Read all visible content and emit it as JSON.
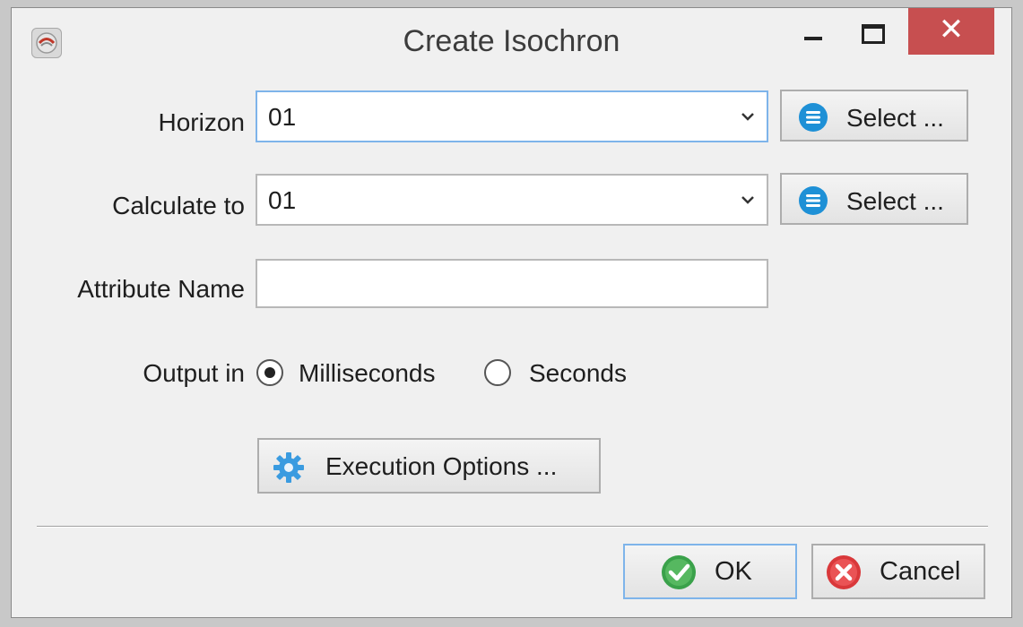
{
  "window": {
    "title": "Create Isochron",
    "close_glyph": "✕",
    "app_icon": "app-icon",
    "colors": {
      "close_bg": "#c74f50",
      "focus_border": "#7eb4ea",
      "select_icon": "#1e90d6",
      "ok_icon": "#3aa14a",
      "cancel_icon": "#d9383a"
    }
  },
  "form": {
    "horizon": {
      "label": "Horizon",
      "value": "01",
      "select_label": "Select ..."
    },
    "calculate_to": {
      "label": "Calculate to",
      "value": "01",
      "select_label": "Select ..."
    },
    "attribute_name": {
      "label": "Attribute Name",
      "value": ""
    },
    "output_in": {
      "label": "Output in",
      "options": [
        {
          "label": "Milliseconds",
          "selected": true
        },
        {
          "label": "Seconds",
          "selected": false
        }
      ]
    },
    "execution_options_label": "Execution Options ..."
  },
  "buttons": {
    "ok": "OK",
    "cancel": "Cancel"
  }
}
